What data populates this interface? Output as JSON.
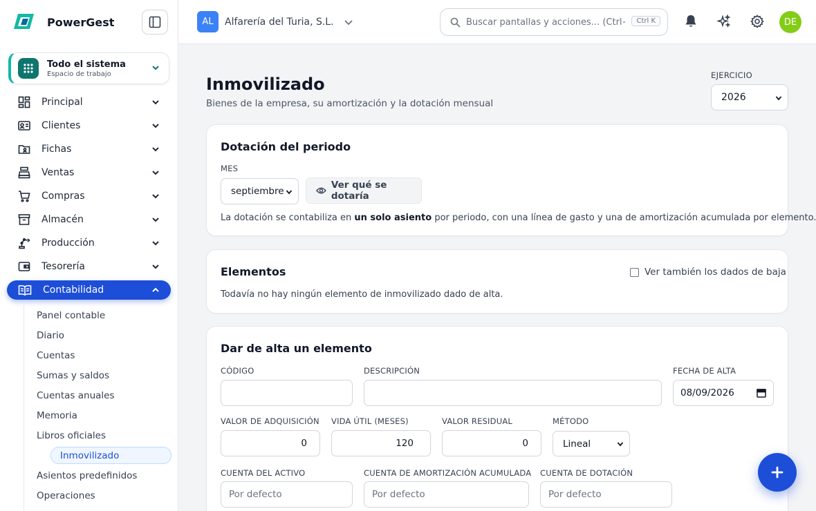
{
  "app": {
    "name": "PowerGest"
  },
  "workspace": {
    "title": "Todo el sistema",
    "subtitle": "Espacio de trabajo"
  },
  "nav": [
    {
      "label": "Principal",
      "icon": "dashboard-icon"
    },
    {
      "label": "Clientes",
      "icon": "contact-card-icon"
    },
    {
      "label": "Fichas",
      "icon": "folder-user-icon"
    },
    {
      "label": "Ventas",
      "icon": "cash-register-icon"
    },
    {
      "label": "Compras",
      "icon": "cart-icon"
    },
    {
      "label": "Almacén",
      "icon": "archive-box-icon"
    },
    {
      "label": "Producción",
      "icon": "robot-arm-icon"
    },
    {
      "label": "Tesorería",
      "icon": "wallet-icon"
    },
    {
      "label": "Contabilidad",
      "icon": "book-icon",
      "active": true
    }
  ],
  "subnav": [
    "Panel contable",
    "Diario",
    "Cuentas",
    "Sumas y saldos",
    "Cuentas anuales",
    "Memoria",
    "Libros oficiales",
    "Inmovilizado",
    "Asientos predefinidos",
    "Operaciones"
  ],
  "header": {
    "company_initials": "AL",
    "company_name": "Alfarería del Turia, S.L.",
    "search_placeholder": "Buscar pantallas y acciones... (Ctrl+K)",
    "search_shortcut": "Ctrl K",
    "user_initials": "DE"
  },
  "page": {
    "title": "Inmovilizado",
    "subtitle": "Bienes de la empresa, su amortización y la dotación mensual",
    "ejercicio_label": "EJERCICIO",
    "ejercicio_value": "2026"
  },
  "dotacion": {
    "title": "Dotación del periodo",
    "mes_label": "MES",
    "mes_value": "septiembre",
    "button": "Ver qué se dotaría",
    "note_pre": "La dotación se contabiliza en ",
    "note_bold": "un solo asiento",
    "note_post": " por periodo, con una línea de gasto y una de amortización acumulada por elemento."
  },
  "elementos": {
    "title": "Elementos",
    "checkbox_label": "Ver también los dados de baja",
    "empty": "Todavía no hay ningún elemento de inmovilizado dado de alta."
  },
  "alta": {
    "title": "Dar de alta un elemento",
    "codigo_label": "CÓDIGO",
    "descripcion_label": "DESCRIPCIÓN",
    "fecha_label": "FECHA DE ALTA",
    "fecha_value": "08/09/2026",
    "valor_label": "VALOR DE ADQUISICIÓN",
    "valor_value": "0",
    "vida_label": "VIDA ÚTIL (MESES)",
    "vida_value": "120",
    "residual_label": "VALOR RESIDUAL",
    "residual_value": "0",
    "metodo_label": "MÉTODO",
    "metodo_value": "Lineal",
    "cuenta_activo_label": "CUENTA DEL ACTIVO",
    "cuenta_amort_label": "CUENTA DE AMORTIZACIÓN ACUMULADA",
    "cuenta_dot_label": "CUENTA DE DOTACIÓN",
    "default_placeholder": "Por defecto"
  },
  "colors": {
    "primary": "#1d4ed8",
    "teal": "#0f766e",
    "avatar": "#84cc16"
  }
}
